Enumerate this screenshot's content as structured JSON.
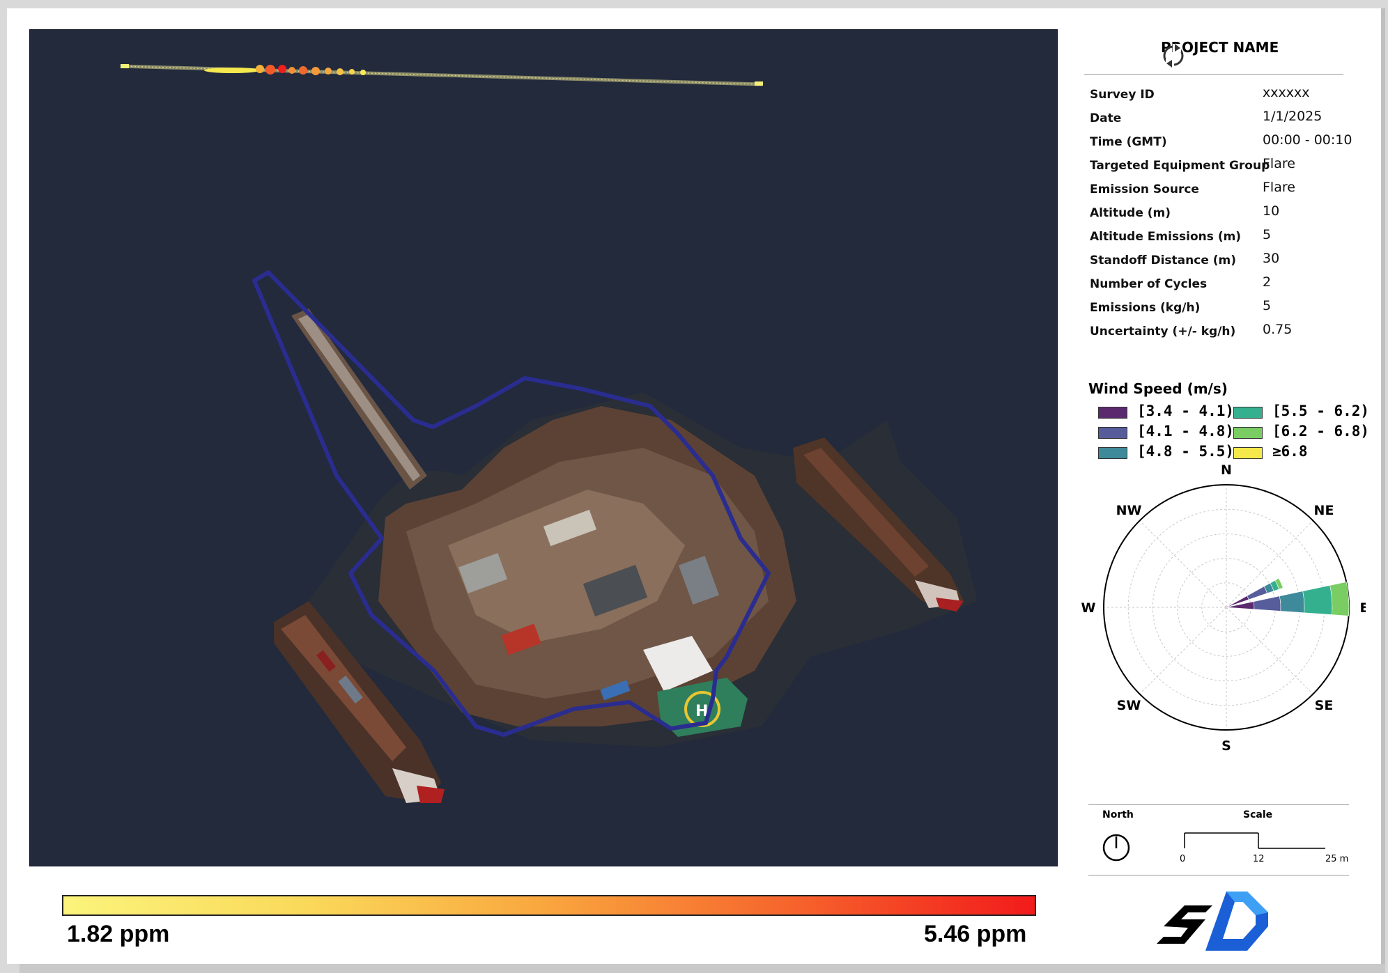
{
  "report": {
    "title": "PROJECT NAME",
    "fields": [
      {
        "key": "Survey ID",
        "value": "xxxxxx"
      },
      {
        "key": "Date",
        "value": "1/1/2025"
      },
      {
        "key": "Time (GMT)",
        "value": "00:00 - 00:10"
      },
      {
        "key": "Targeted Equipment Group",
        "value": "Flare"
      },
      {
        "key": "Emission Source",
        "value": "Flare"
      },
      {
        "key": "Altitude (m)",
        "value": "10"
      },
      {
        "key": "Altitude Emissions (m)",
        "value": "5"
      },
      {
        "key": "Standoff Distance (m)",
        "value": "30"
      },
      {
        "key": "Number of Cycles",
        "value": "2"
      },
      {
        "key": "Emissions (kg/h)",
        "value": "5"
      },
      {
        "key": "Uncertainty (+/- kg/h)",
        "value": "0.75"
      }
    ]
  },
  "concentration_scale": {
    "min_label": "1.82 ppm",
    "max_label": "5.46 ppm",
    "colors": [
      "#fbf47c",
      "#fad95a",
      "#f9a53e",
      "#f6642c",
      "#f21b1b"
    ]
  },
  "wind": {
    "title": "Wind Speed (m/s)",
    "legend": [
      {
        "label": "[3.4 - 4.1)",
        "color": "#5b2a6e"
      },
      {
        "label": "[4.1 - 4.8)",
        "color": "#575d9a"
      },
      {
        "label": "[4.8 - 5.5)",
        "color": "#3f8a9a"
      },
      {
        "label": "[5.5 - 6.2)",
        "color": "#34b08f"
      },
      {
        "label": "[6.2 - 6.8)",
        "color": "#79cd62"
      },
      {
        "label": "≥6.8",
        "color": "#f4e84a"
      }
    ],
    "directions": [
      "N",
      "NE",
      "E",
      "SE",
      "S",
      "SW",
      "W",
      "NW"
    ]
  },
  "scale_bar": {
    "north_label": "North",
    "scale_label": "Scale",
    "ticks": [
      "0",
      "12",
      "25 m"
    ]
  },
  "icons": {
    "refresh": "refresh-icon",
    "north": "north-arrow-icon",
    "logo": "sd-logo"
  }
}
